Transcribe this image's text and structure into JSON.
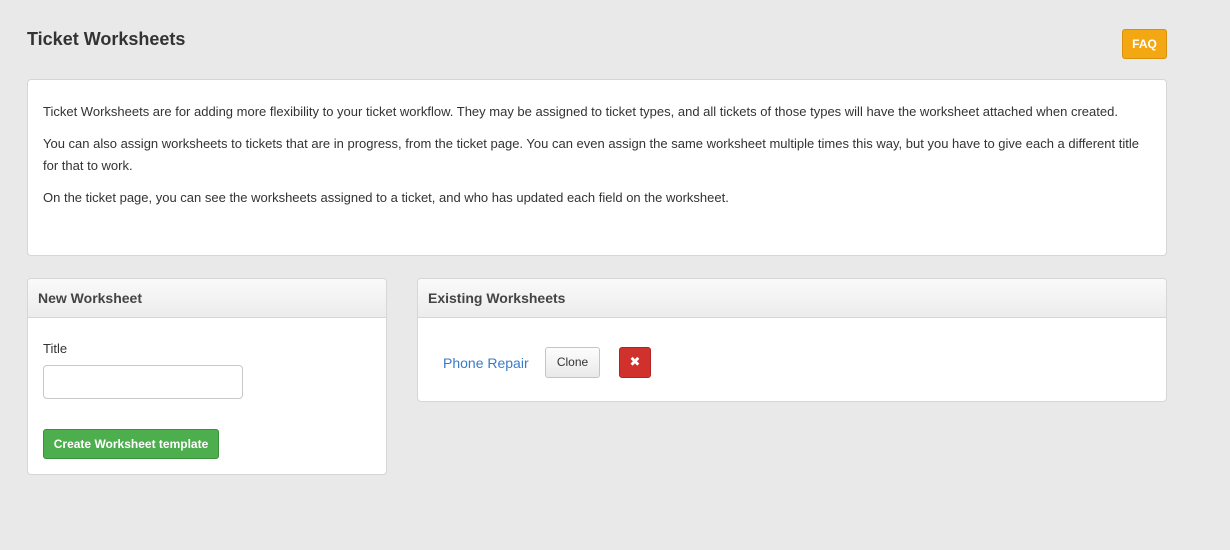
{
  "page": {
    "title": "Ticket Worksheets",
    "faq_label": "FAQ"
  },
  "info": {
    "paragraphs": [
      "Ticket Worksheets are for adding more flexibility to your ticket workflow. They may be assigned to ticket types, and all tickets of those types will have the worksheet attached when created.",
      "You can also assign worksheets to tickets that are in progress, from the ticket page. You can even assign the same worksheet multiple times this way, but you have to give each a different title for that to work.",
      "On the ticket page, you can see the worksheets assigned to a ticket, and who has updated each field on the worksheet."
    ]
  },
  "new_worksheet": {
    "heading": "New Worksheet",
    "title_label": "Title",
    "title_value": "",
    "title_placeholder": "",
    "create_label": "Create Worksheet template"
  },
  "existing_worksheets": {
    "heading": "Existing Worksheets",
    "items": [
      {
        "name": "Phone Repair",
        "clone_label": "Clone",
        "delete_icon": "close-icon",
        "delete_glyph": "✖"
      }
    ]
  },
  "colors": {
    "faq": "#f3a712",
    "create": "#4cae4c",
    "delete": "#d0312d",
    "link": "#3a7bc8"
  }
}
